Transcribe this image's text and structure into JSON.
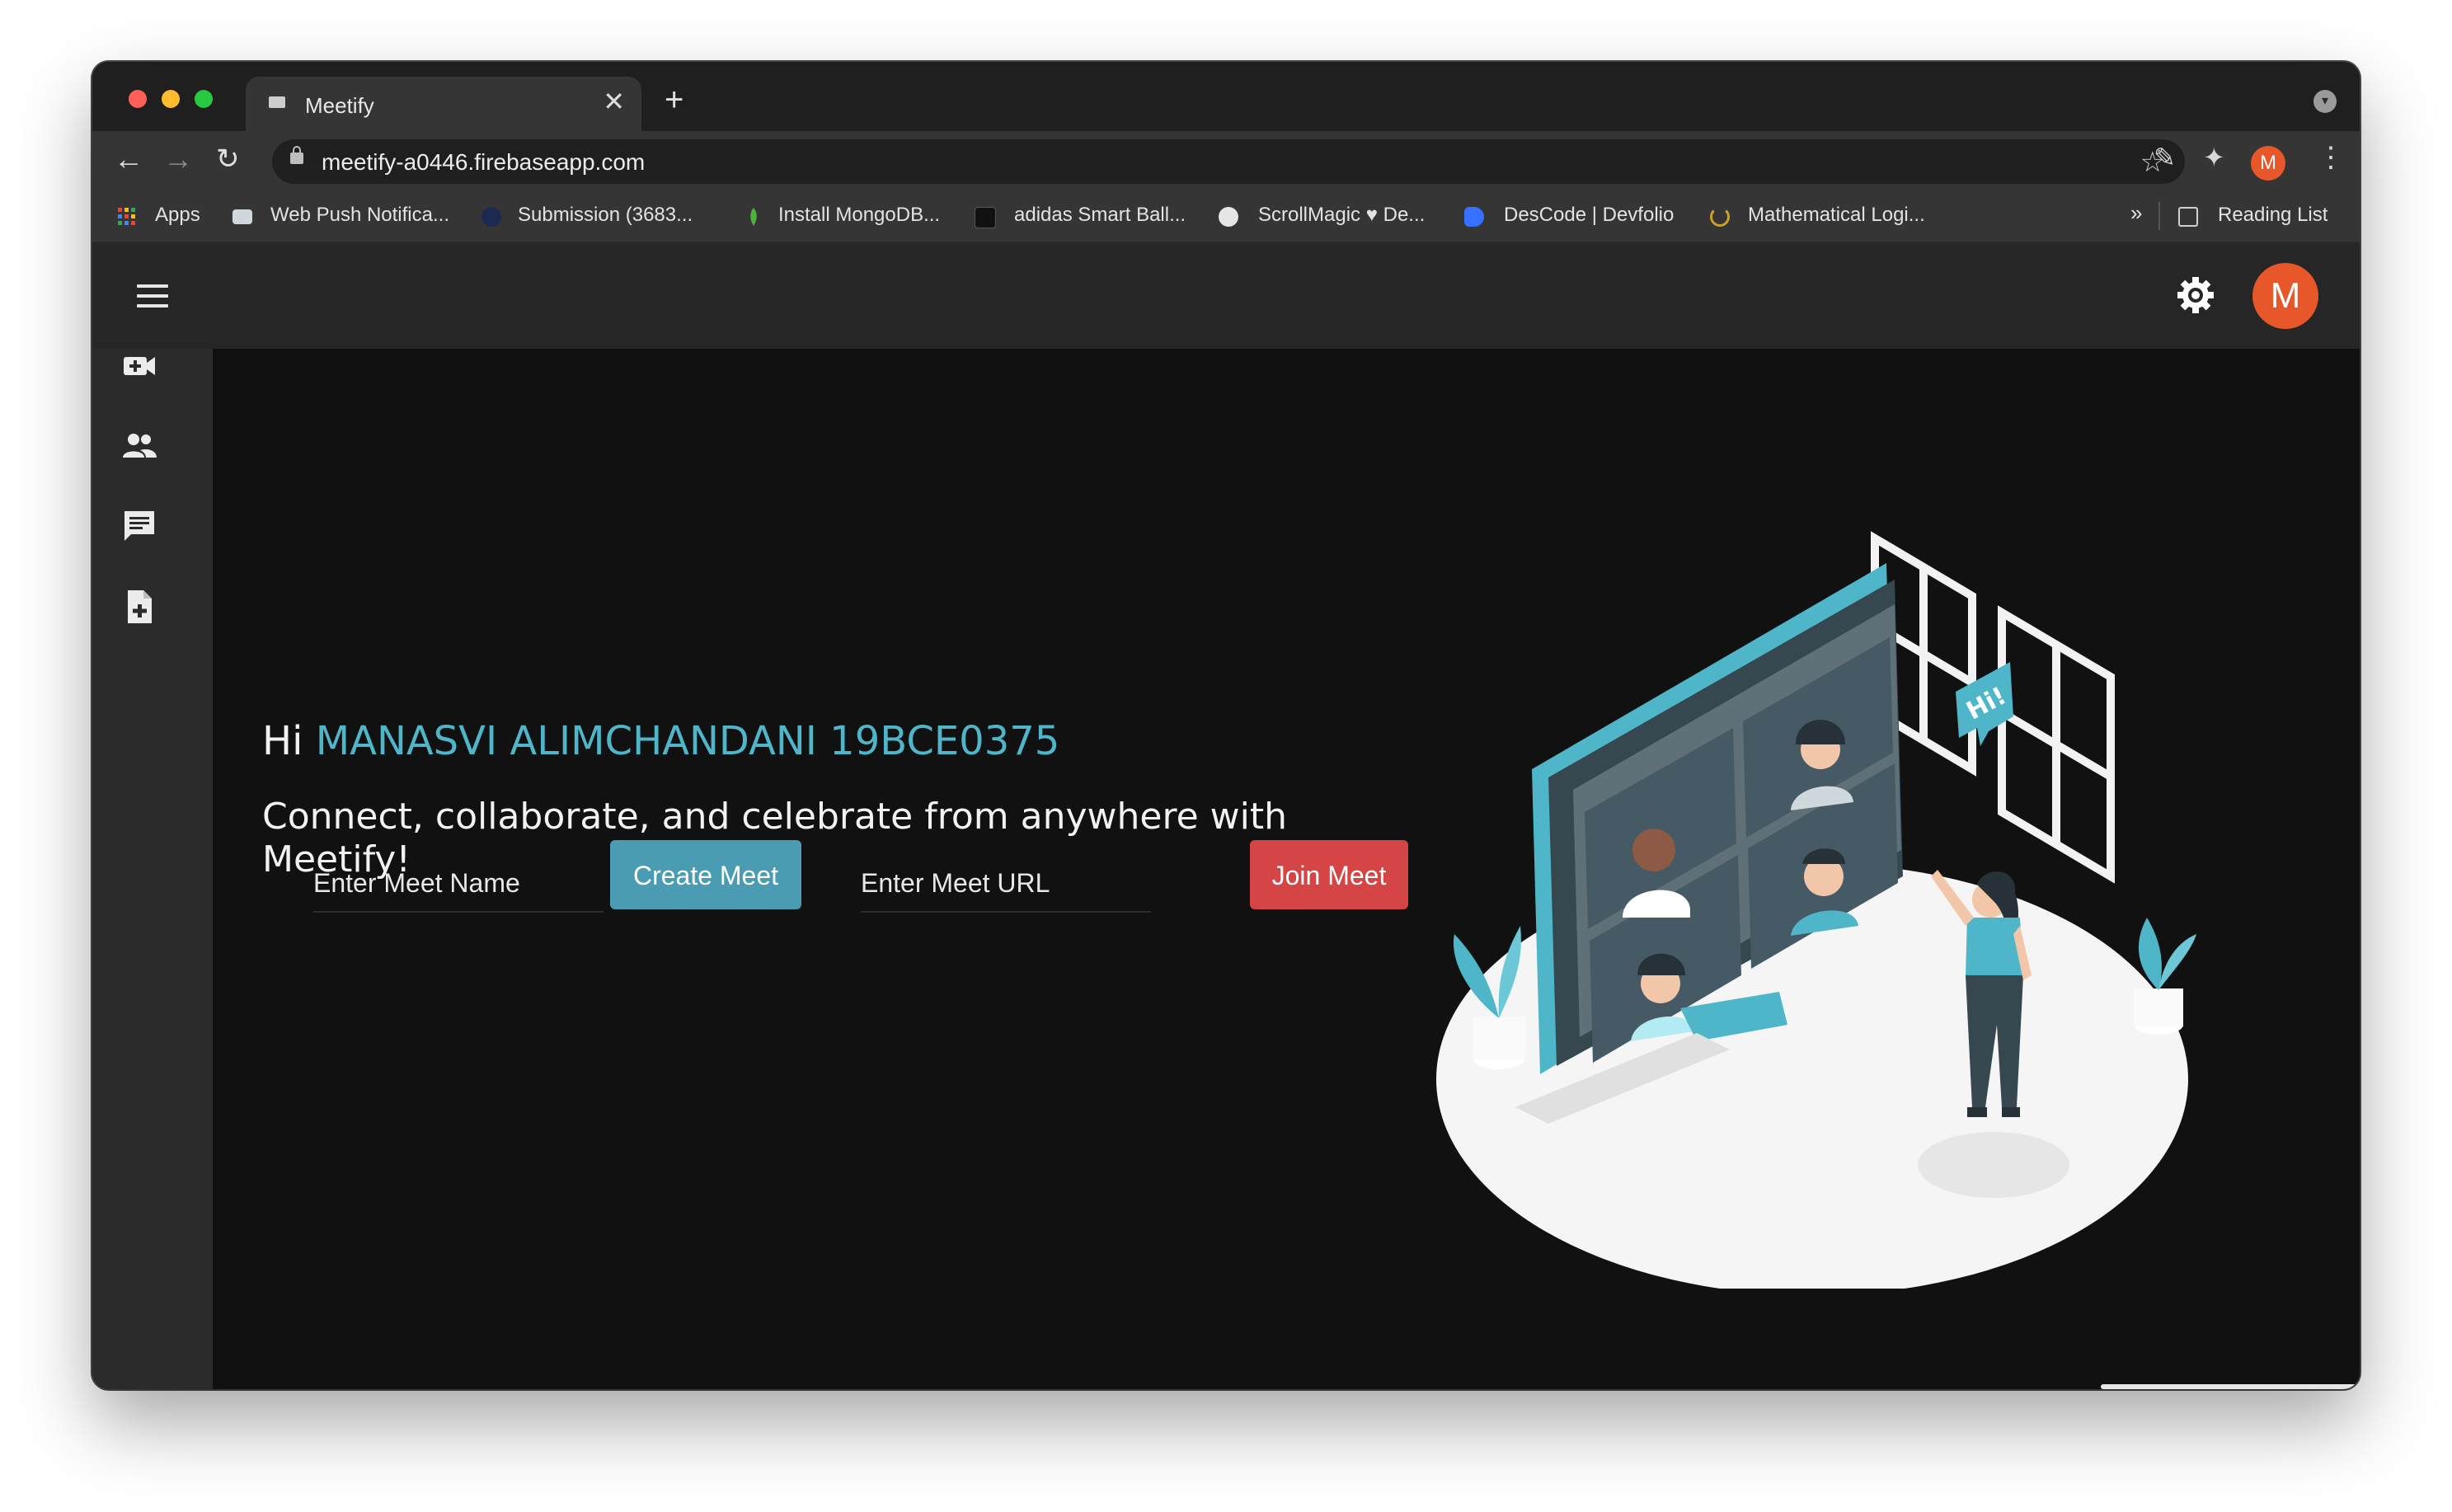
{
  "browser": {
    "tab_title": "Meetify",
    "tab_close": "✕",
    "new_tab": "+",
    "url": "meetify-a0446.firebaseapp.com",
    "profile_initial": "M",
    "bookmarks": [
      {
        "label": "Apps",
        "icon": "apps-grid-icon"
      },
      {
        "label": "Web Push Notifica...",
        "icon": "web-push-icon"
      },
      {
        "label": "Submission (3683...",
        "icon": "submission-icon"
      },
      {
        "label": "Install MongoDB...",
        "icon": "mongodb-leaf-icon"
      },
      {
        "label": "adidas Smart Ball...",
        "icon": "adidas-icon"
      },
      {
        "label": "ScrollMagic ♥ De...",
        "icon": "globe-icon"
      },
      {
        "label": "DesCode | Devfolio",
        "icon": "devfolio-icon"
      },
      {
        "label": "Mathematical Logi...",
        "icon": "loading-icon"
      }
    ],
    "more_bookmarks": "»",
    "reading_list": "Reading List"
  },
  "appbar": {
    "avatar_initial": "M",
    "accent_color": "#e8572a"
  },
  "sidebar": {
    "items": [
      {
        "icon": "new-video-call-icon"
      },
      {
        "icon": "people-icon"
      },
      {
        "icon": "chat-icon"
      },
      {
        "icon": "add-document-icon"
      }
    ]
  },
  "hero": {
    "greeting": "Hi ",
    "user_name": "MANASVI ALIMCHANDANI 19BCE0375",
    "tagline": "Connect, collaborate, and celebrate from anywhere with Meetify!",
    "meet_name_placeholder": "Enter Meet Name",
    "create_button": "Create Meet",
    "meet_url_placeholder": "Enter Meet URL",
    "join_button": "Join Meet",
    "illustration_text": "Hi!",
    "create_color": "#4a9cb2",
    "join_color": "#d64545"
  }
}
